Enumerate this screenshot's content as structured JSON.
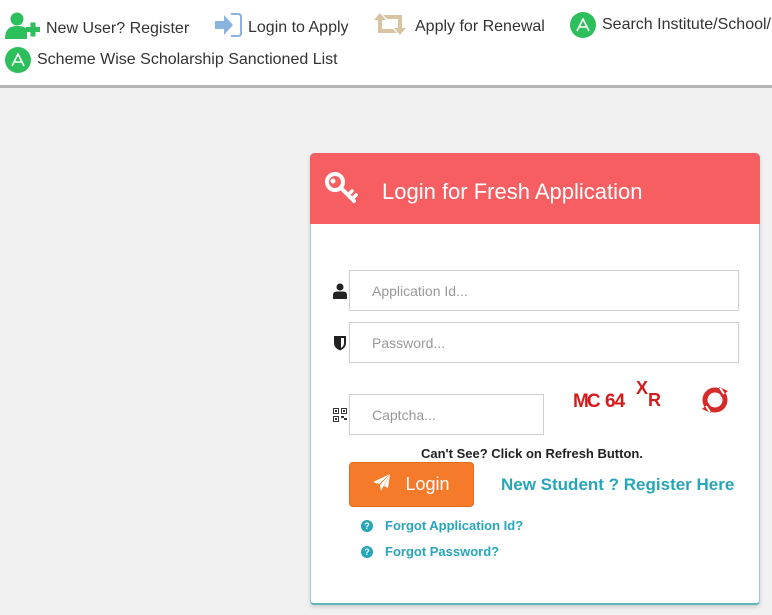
{
  "nav": {
    "items": [
      {
        "label": "New User? Register",
        "icon": "user-plus-icon"
      },
      {
        "label": "Login to Apply",
        "icon": "sign-in-icon"
      },
      {
        "label": "Apply for Renewal",
        "icon": "retweet-icon"
      },
      {
        "label": "Search Institute/School/I",
        "icon": "circle-a-icon"
      },
      {
        "label": "Scheme Wise Scholarship Sanctioned List",
        "icon": "circle-a-icon"
      }
    ]
  },
  "login_card": {
    "title": "Login for Fresh Application",
    "header_color": "#f65e62",
    "application_id": {
      "placeholder": "Application Id...",
      "value": ""
    },
    "password": {
      "placeholder": "Password...",
      "value": ""
    },
    "captcha": {
      "placeholder": "Captcha...",
      "value": "",
      "image_text": "MC 64 XR"
    },
    "hint": "Can't See? Click on Refresh Button.",
    "login_label": "Login",
    "register_link": "New Student ? Register Here",
    "forgot_application_id": "Forgot Application Id?",
    "forgot_password": "Forgot Password?",
    "accent_color": "#26a6b8",
    "button_color": "#f57a29"
  }
}
